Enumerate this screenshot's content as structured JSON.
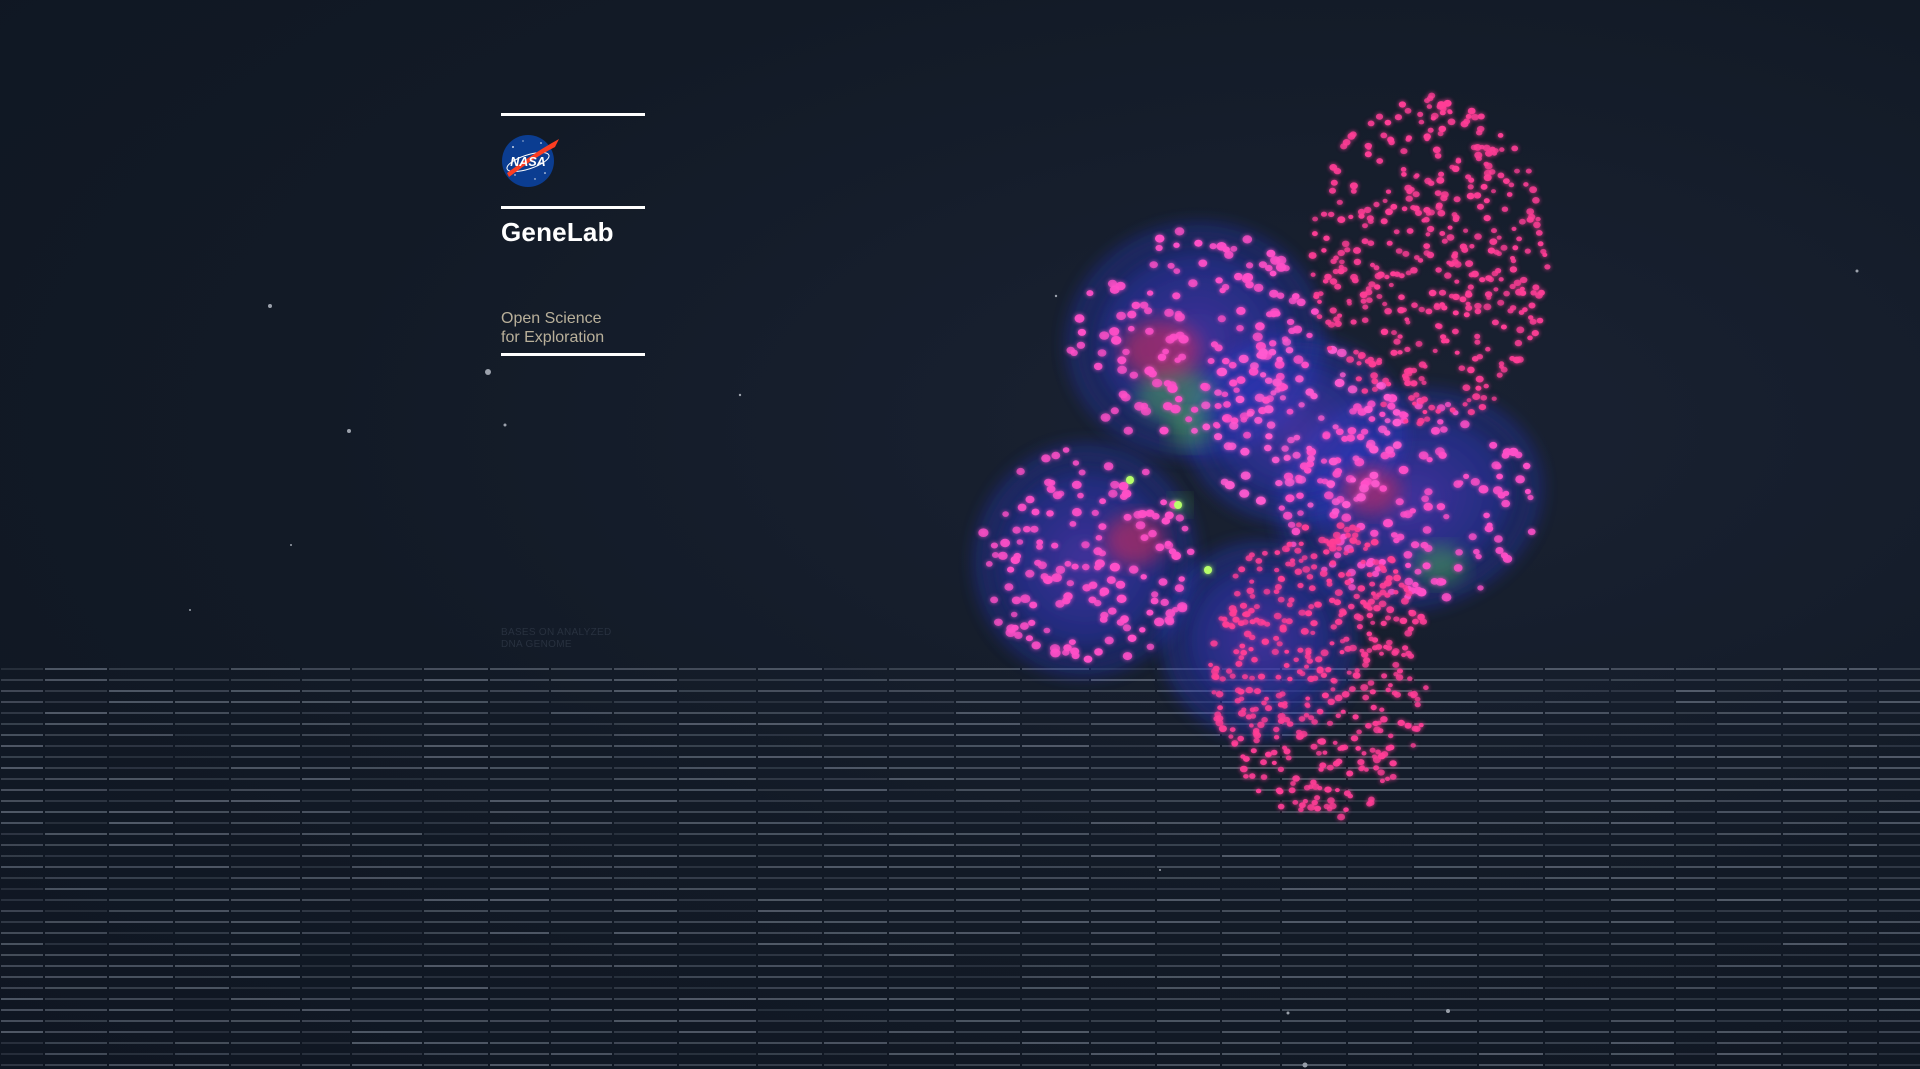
{
  "brand": {
    "logo_text": "NASA",
    "logo_icon": "nasa-meatball-icon",
    "title": "GeneLab",
    "tagline_line1": "Open Science",
    "tagline_line2": "for Exploration"
  },
  "caption": {
    "line1": "BASES ON ANALYZED",
    "line2": "DNA GENOME"
  },
  "colors": {
    "background": "#121a26",
    "rule": "#ffffff",
    "tagline": "#b9b09a",
    "nasa_blue": "#0b3d91",
    "nasa_red": "#fc3d21",
    "nucleus_pink": "#ff3d96",
    "membrane_blue": "#3a4dff",
    "fluor_green": "#7dff4a"
  },
  "visuals": {
    "hero_image": "fluorescent-cell-organoid",
    "background_pattern": "dna-sequence-bars"
  }
}
